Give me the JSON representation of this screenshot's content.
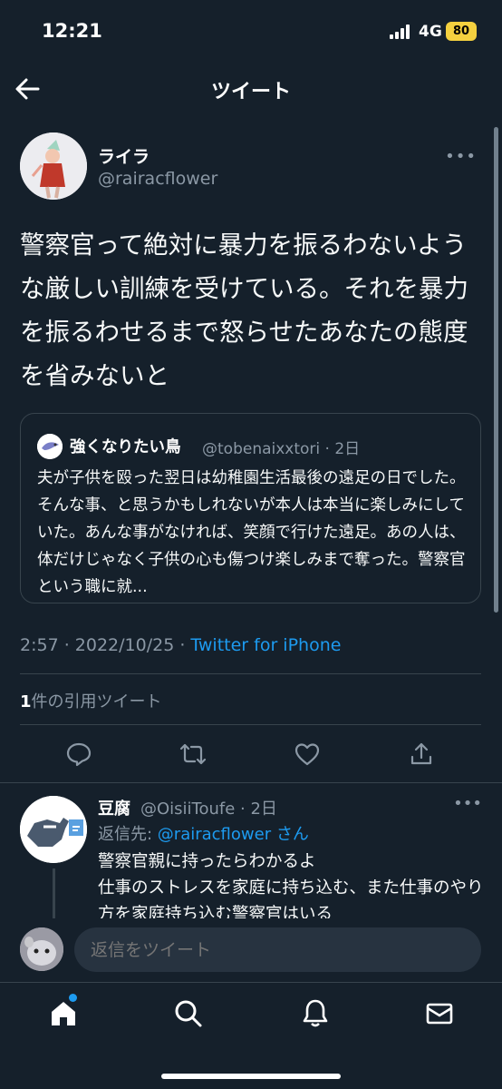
{
  "status": {
    "time": "12:21",
    "network": "4G",
    "battery": "80"
  },
  "topbar": {
    "title": "ツイート"
  },
  "tweet": {
    "author_name": "ライラ",
    "author_handle": "@rairacflower",
    "more": "•••",
    "text": "警察官って絶対に暴力を振るわないような厳しい訓練を受けている。それを暴力を振るわせるまで怒らせたあなたの態度を省みないと",
    "timestamp": "2:57 · 2022/10/25 · ",
    "source": "Twitter for iPhone",
    "quote_count": "1",
    "quote_count_label": "件の引用ツイート"
  },
  "quoted": {
    "name": "強くなりたい鳥",
    "handle": "@tobenaixxtori · 2日",
    "text": "夫が子供を殴った翌日は幼稚園生活最後の遠足の日でした。そんな事、と思うかもしれないが本人は本当に楽しみにしていた。あんな事がなければ、笑顔で行けた遠足。あの人は、体だけじゃなく子供の心も傷つけ楽しみまで奪った。警察官という職に就..."
  },
  "reply": {
    "name": "豆腐",
    "handle": "@OisiiToufe · 2日",
    "more": "•••",
    "reply_to_prefix": "返信先: ",
    "reply_to_mention": "@rairacflower",
    "reply_to_suffix": " さん",
    "text": "警察官親に持ったらわかるよ\n仕事のストレスを家庭に持ち込む、また仕事のやり方を家庭持ち込む警察官はいる"
  },
  "compose": {
    "placeholder": "返信をツイート"
  },
  "icons": [
    "back-arrow-icon",
    "reply-icon",
    "retweet-icon",
    "like-icon",
    "share-icon",
    "home-icon",
    "search-icon",
    "bell-icon",
    "mail-icon"
  ],
  "colors": {
    "background": "#15202b",
    "accent": "#1d9bf0",
    "muted": "#8b98a5",
    "border": "#38444d"
  }
}
